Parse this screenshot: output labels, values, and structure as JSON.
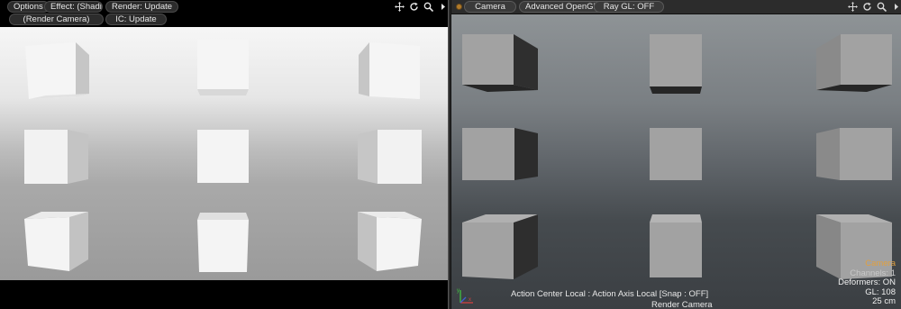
{
  "left_viewport": {
    "toolbar": {
      "options_label": "Options",
      "effect_label": "Effect: (Shadi...",
      "render_label": "Render: Update",
      "camera_label": "(Render Camera)",
      "ic_label": "IC: Update"
    },
    "toolbar_icons": [
      "move-view-icon",
      "rotate-view-icon",
      "zoom-view-icon",
      "expand-arrow-icon"
    ]
  },
  "right_viewport": {
    "toolbar": {
      "camera_label": "Camera",
      "shading_label": "Advanced OpenGL",
      "raygl_label": "Ray GL: OFF"
    },
    "toolbar_icons": [
      "move-view-icon",
      "rotate-view-icon",
      "zoom-view-icon",
      "expand-arrow-icon"
    ],
    "hud": {
      "camera": "Camera",
      "channels": "Channels: 1",
      "deformers": "Deformers: ON",
      "gl": "GL: 108",
      "scale": "25 cm"
    },
    "status": {
      "action_center": "Action Center Local : Action Axis Local  [Snap : OFF]",
      "view_camera": "Render Camera"
    }
  },
  "colors": {
    "left_face": "#f4f4f4",
    "left_side": "#c9c9c9",
    "right_face": "#a0a0a0",
    "right_side_dark": "#2e2e2e",
    "right_side_mid": "#888888",
    "hud_camera": "#e0a040"
  }
}
